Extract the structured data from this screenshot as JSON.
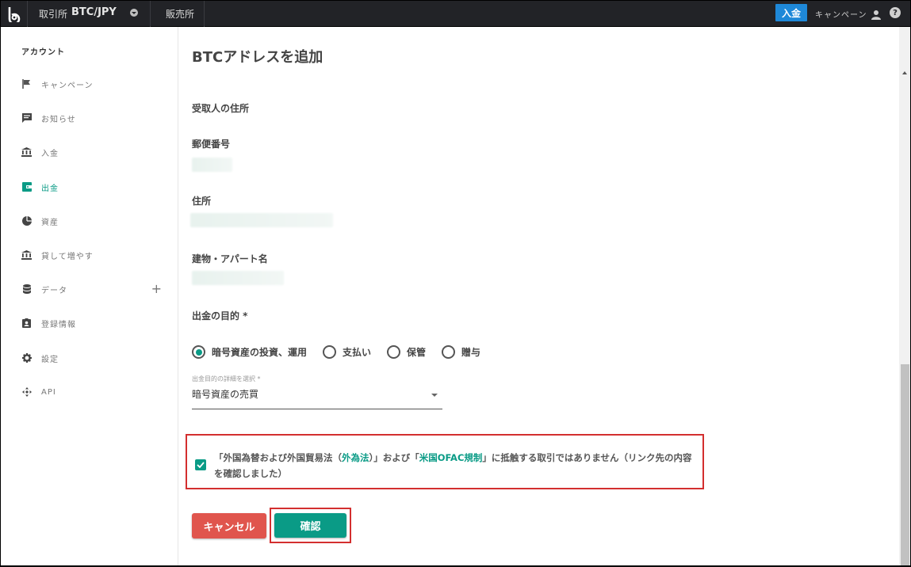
{
  "topbar": {
    "exchange_label": "取引所",
    "pair": "BTC/JPY",
    "shop_label": "販売所",
    "deposit_button": "入金",
    "campaign_link": "キャンペーン",
    "help_glyph": "?"
  },
  "sidebar": {
    "heading": "アカウント",
    "items": [
      {
        "label": "キャンペーン",
        "icon": "flag-icon"
      },
      {
        "label": "お知らせ",
        "icon": "message-icon"
      },
      {
        "label": "入金",
        "icon": "bank-icon"
      },
      {
        "label": "出金",
        "icon": "wallet-icon",
        "active": true
      },
      {
        "label": "資産",
        "icon": "pie-chart-icon"
      },
      {
        "label": "貸して増やす",
        "icon": "bank-icon"
      },
      {
        "label": "データ",
        "icon": "database-icon",
        "expand": "+"
      },
      {
        "label": "登録情報",
        "icon": "id-badge-icon"
      },
      {
        "label": "設定",
        "icon": "gear-icon"
      },
      {
        "label": "API",
        "icon": "api-icon"
      }
    ]
  },
  "main": {
    "title": "BTCアドレスを追加",
    "recipient_address_heading": "受取人の住所",
    "postal_code_label": "郵便番号",
    "address_label": "住所",
    "building_label": "建物・アパート名",
    "purpose_label": "出金の目的 *",
    "purpose_options": [
      {
        "label": "暗号資産の投資、運用",
        "selected": true
      },
      {
        "label": "支払い",
        "selected": false
      },
      {
        "label": "保管",
        "selected": false
      },
      {
        "label": "贈与",
        "selected": false
      }
    ],
    "detail_select": {
      "label": "出金目的の詳細を選択 *",
      "value": "暗号資産の売買"
    },
    "confirmation": {
      "checked": true,
      "text_part1": "「外国為替および外国貿易法（",
      "link1": "外為法",
      "text_part2": "）」および「",
      "link2": "米国OFAC規制",
      "text_part3": "」に抵触する取引ではありません（リンク先の内容を確認しました）"
    },
    "cancel_button": "キャンセル",
    "confirm_button": "確認"
  },
  "colors": {
    "accent": "#0a9b86",
    "danger": "#e0554d",
    "highlight_border": "#d32f2f",
    "topbar_bg": "#222327",
    "deposit_bg": "#1e88d8"
  }
}
